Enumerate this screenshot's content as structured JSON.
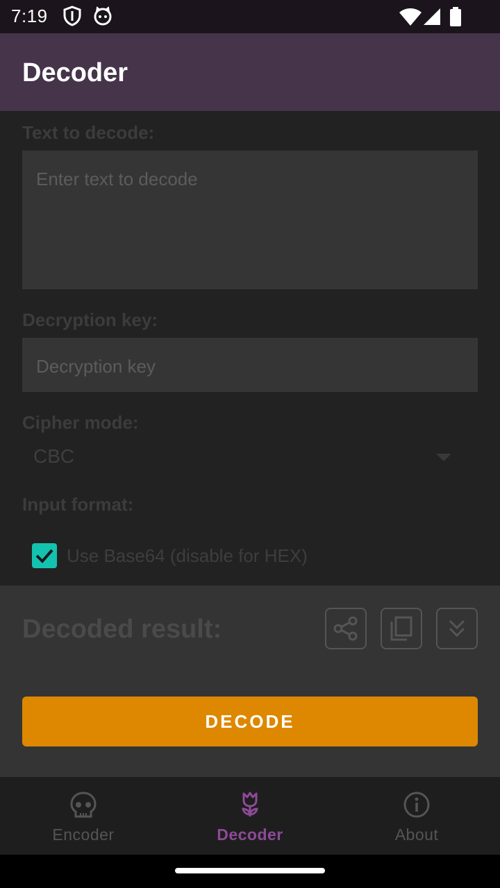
{
  "status_bar": {
    "time": "7:19"
  },
  "app_bar": {
    "title": "Decoder"
  },
  "form": {
    "text_label": "Text to decode:",
    "text_placeholder": "Enter text to decode",
    "key_label": "Decryption key:",
    "key_placeholder": "Decryption key",
    "cipher_label": "Cipher mode:",
    "cipher_value": "CBC",
    "input_format_label": "Input format:",
    "base64_label": "Use Base64 (disable for HEX)",
    "base64_checked": true
  },
  "result": {
    "label": "Decoded result:",
    "actions": [
      "share-icon",
      "copy-icon",
      "expand-icon"
    ]
  },
  "decode_button": "DECODE",
  "nav": {
    "items": [
      {
        "label": "Encoder",
        "icon": "skull-icon",
        "active": false
      },
      {
        "label": "Decoder",
        "icon": "flower-icon",
        "active": true
      },
      {
        "label": "About",
        "icon": "info-icon",
        "active": false
      }
    ]
  },
  "colors": {
    "accent": "#dd8800",
    "checkbox": "#14c2b0",
    "app_bar": "#45344a",
    "nav_active": "#8e4a98"
  }
}
